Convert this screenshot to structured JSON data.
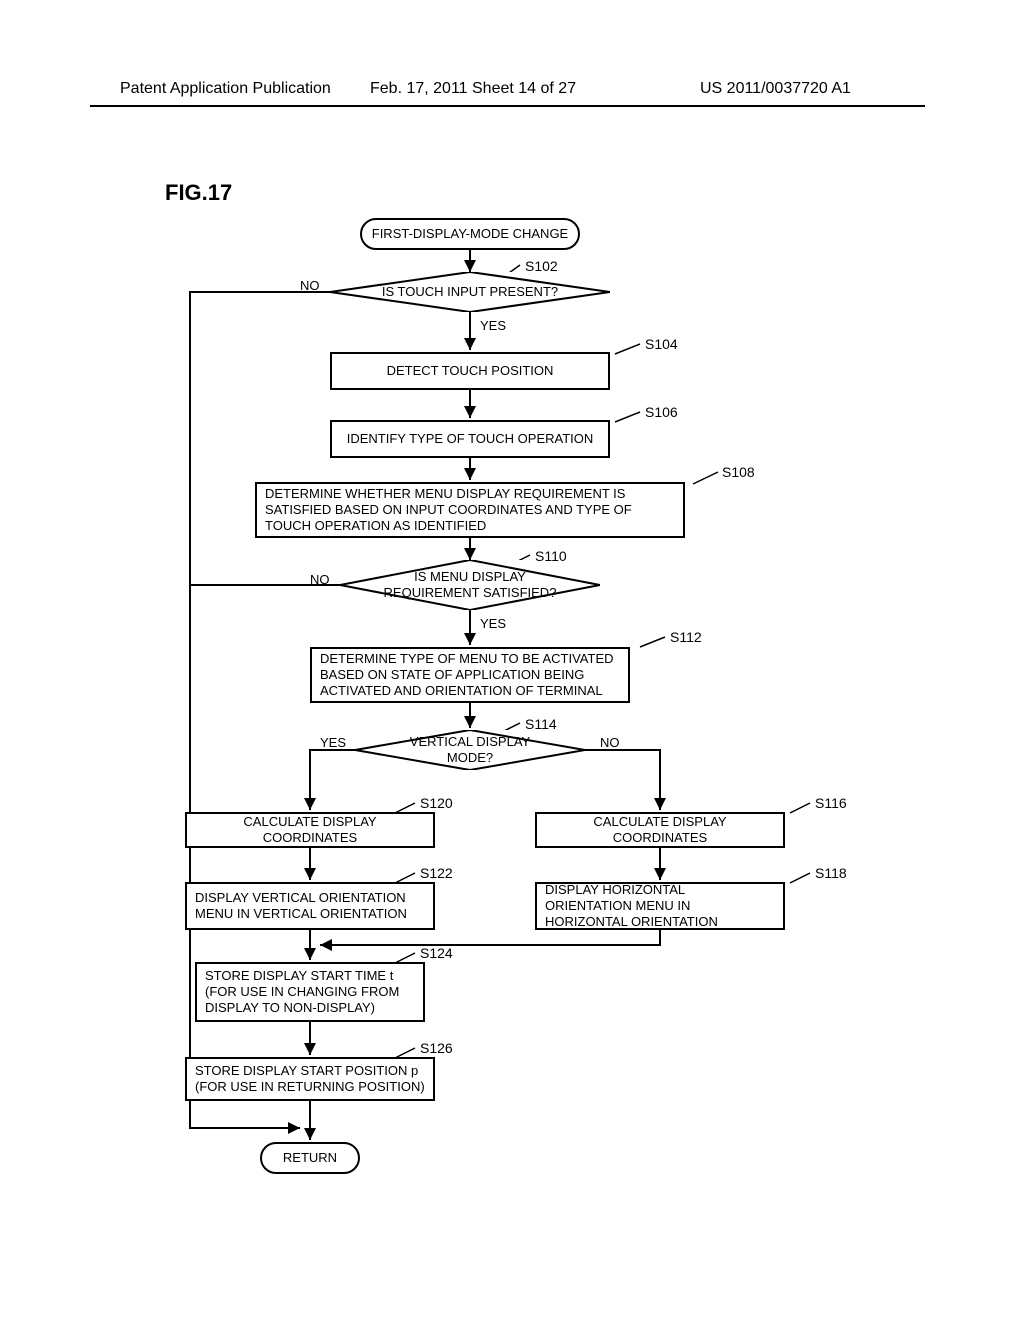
{
  "header": {
    "left": "Patent Application Publication",
    "mid": "Feb. 17, 2011  Sheet 14 of 27",
    "right": "US 2011/0037720 A1"
  },
  "figure_label": "FIG.17",
  "nodes": {
    "start": "FIRST-DISPLAY-MODE CHANGE",
    "s102": "IS TOUCH INPUT PRESENT?",
    "s104": "DETECT TOUCH POSITION",
    "s106": "IDENTIFY TYPE OF TOUCH OPERATION",
    "s108": "DETERMINE WHETHER MENU DISPLAY REQUIREMENT IS SATISFIED BASED ON INPUT COORDINATES AND TYPE OF TOUCH OPERATION AS IDENTIFIED",
    "s110": "IS MENU DISPLAY\nREQUIREMENT SATISFIED?",
    "s112": "DETERMINE TYPE OF MENU TO BE ACTIVATED BASED ON STATE OF APPLICATION BEING ACTIVATED AND ORIENTATION OF TERMINAL",
    "s114": "VERTICAL DISPLAY MODE?",
    "s116": "CALCULATE DISPLAY COORDINATES",
    "s118": "DISPLAY HORIZONTAL ORIENTATION MENU IN HORIZONTAL ORIENTATION",
    "s120": "CALCULATE DISPLAY COORDINATES",
    "s122": "DISPLAY VERTICAL ORIENTATION MENU IN VERTICAL ORIENTATION",
    "s124": "STORE DISPLAY START TIME t (FOR USE IN CHANGING FROM DISPLAY TO NON-DISPLAY)",
    "s126": "STORE DISPLAY START POSITION p (FOR USE IN RETURNING POSITION)",
    "return": "RETURN"
  },
  "step_labels": {
    "s102": "S102",
    "s104": "S104",
    "s106": "S106",
    "s108": "S108",
    "s110": "S110",
    "s112": "S112",
    "s114": "S114",
    "s116": "S116",
    "s118": "S118",
    "s120": "S120",
    "s122": "S122",
    "s124": "S124",
    "s126": "S126"
  },
  "edge_labels": {
    "yes": "YES",
    "no": "NO"
  },
  "chart_data": {
    "type": "flowchart",
    "nodes": [
      {
        "id": "start",
        "type": "terminator",
        "label": "FIRST-DISPLAY-MODE CHANGE"
      },
      {
        "id": "S102",
        "type": "decision",
        "label": "IS TOUCH INPUT PRESENT?"
      },
      {
        "id": "S104",
        "type": "process",
        "label": "DETECT TOUCH POSITION"
      },
      {
        "id": "S106",
        "type": "process",
        "label": "IDENTIFY TYPE OF TOUCH OPERATION"
      },
      {
        "id": "S108",
        "type": "process",
        "label": "DETERMINE WHETHER MENU DISPLAY REQUIREMENT IS SATISFIED BASED ON INPUT COORDINATES AND TYPE OF TOUCH OPERATION AS IDENTIFIED"
      },
      {
        "id": "S110",
        "type": "decision",
        "label": "IS MENU DISPLAY REQUIREMENT SATISFIED?"
      },
      {
        "id": "S112",
        "type": "process",
        "label": "DETERMINE TYPE OF MENU TO BE ACTIVATED BASED ON STATE OF APPLICATION BEING ACTIVATED AND ORIENTATION OF TERMINAL"
      },
      {
        "id": "S114",
        "type": "decision",
        "label": "VERTICAL DISPLAY MODE?"
      },
      {
        "id": "S120",
        "type": "process",
        "label": "CALCULATE DISPLAY COORDINATES"
      },
      {
        "id": "S122",
        "type": "process",
        "label": "DISPLAY VERTICAL ORIENTATION MENU IN VERTICAL ORIENTATION"
      },
      {
        "id": "S116",
        "type": "process",
        "label": "CALCULATE DISPLAY COORDINATES"
      },
      {
        "id": "S118",
        "type": "process",
        "label": "DISPLAY HORIZONTAL ORIENTATION MENU IN HORIZONTAL ORIENTATION"
      },
      {
        "id": "S124",
        "type": "process",
        "label": "STORE DISPLAY START TIME t (FOR USE IN CHANGING FROM DISPLAY TO NON-DISPLAY)"
      },
      {
        "id": "S126",
        "type": "process",
        "label": "STORE DISPLAY START POSITION p (FOR USE IN RETURNING POSITION)"
      },
      {
        "id": "return",
        "type": "terminator",
        "label": "RETURN"
      }
    ],
    "edges": [
      {
        "from": "start",
        "to": "S102"
      },
      {
        "from": "S102",
        "to": "S104",
        "label": "YES"
      },
      {
        "from": "S102",
        "to": "return",
        "label": "NO",
        "routing": "left-bypass"
      },
      {
        "from": "S104",
        "to": "S106"
      },
      {
        "from": "S106",
        "to": "S108"
      },
      {
        "from": "S108",
        "to": "S110"
      },
      {
        "from": "S110",
        "to": "S112",
        "label": "YES"
      },
      {
        "from": "S110",
        "to": "return",
        "label": "NO",
        "routing": "left-bypass"
      },
      {
        "from": "S112",
        "to": "S114"
      },
      {
        "from": "S114",
        "to": "S120",
        "label": "YES"
      },
      {
        "from": "S114",
        "to": "S116",
        "label": "NO"
      },
      {
        "from": "S120",
        "to": "S122"
      },
      {
        "from": "S116",
        "to": "S118"
      },
      {
        "from": "S122",
        "to": "S124"
      },
      {
        "from": "S118",
        "to": "S124",
        "routing": "merge-left"
      },
      {
        "from": "S124",
        "to": "S126"
      },
      {
        "from": "S126",
        "to": "return"
      }
    ]
  }
}
